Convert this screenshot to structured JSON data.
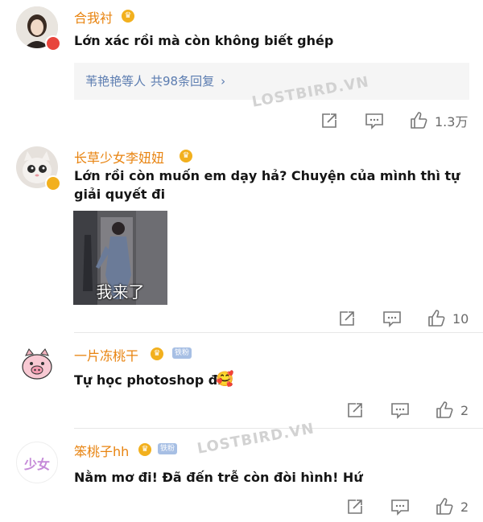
{
  "comments": [
    {
      "username": "合我衬",
      "text": "Lớn xác rồi mà còn không biết ghép",
      "replies_summary": "苇艳艳等人",
      "replies_count": "共98条回复",
      "like_count": "1.3万"
    },
    {
      "username": "长草少女李妞妞",
      "text_line1": "Lớn rồi còn muốn em dạy hả? Chuyện của mình thì tự",
      "text_line2": "giải quyết đi",
      "image_caption": "我来了",
      "like_count": "10"
    },
    {
      "username": "一片冻桃干",
      "fan_badge": "铁粉",
      "text": "Tự học photoshop đi",
      "like_count": "2"
    },
    {
      "username": "笨桃子hh",
      "fan_badge": "铁粉",
      "text": "Nằm mơ đi! Đã đến trễ còn đòi hình! Hứ",
      "like_count": "2",
      "avatar_text": "少女"
    }
  ],
  "watermarks": [
    "LOSTBIRD.VN",
    "LOSTBIRD.VN"
  ],
  "icons": {
    "share": "share-icon",
    "comment": "comment-icon",
    "like": "like-icon",
    "vip": "vip-badge-icon"
  },
  "colors": {
    "username": "#e8830f",
    "reply_link": "#5b7cb0",
    "action_gray": "#6b6b6b",
    "reply_bg": "#f5f5f5",
    "fan_badge": "#a7bfe4"
  }
}
